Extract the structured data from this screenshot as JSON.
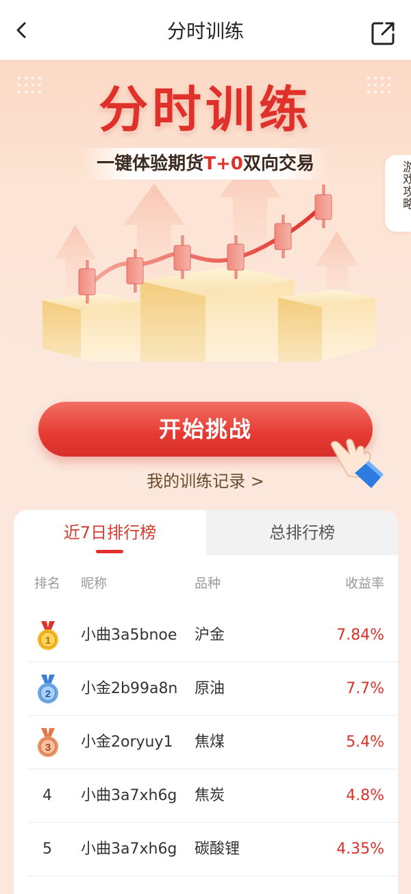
{
  "nav": {
    "title": "分时训练",
    "back_icon": "chevron-left-icon",
    "share_icon": "share-icon"
  },
  "hero": {
    "title": "分时训练",
    "subtitle_prefix": "一键体验期货",
    "subtitle_highlight": "T+0",
    "subtitle_suffix": "双向交易",
    "tips": "游戏攻略"
  },
  "actions": {
    "start_label": "开始挑战",
    "record_link": "我的训练记录 >"
  },
  "leaderboard": {
    "tabs": [
      {
        "label": "近7日排行榜",
        "active": true
      },
      {
        "label": "总排行榜",
        "active": false
      }
    ],
    "columns": {
      "rank": "排名",
      "nickname": "昵称",
      "product": "品种",
      "yield": "收益率"
    },
    "rows": [
      {
        "rank": "1",
        "medal": "gold",
        "nickname": "小曲3a5bnoe",
        "product": "沪金",
        "yield": "7.84%"
      },
      {
        "rank": "2",
        "medal": "silver",
        "nickname": "小金2b99a8n",
        "product": "原油",
        "yield": "7.7%"
      },
      {
        "rank": "3",
        "medal": "bronze",
        "nickname": "小金2oryuy1",
        "product": "焦煤",
        "yield": "5.4%"
      },
      {
        "rank": "4",
        "medal": "",
        "nickname": "小曲3a7xh6g",
        "product": "焦炭",
        "yield": "4.8%"
      },
      {
        "rank": "5",
        "medal": "",
        "nickname": "小曲3a7xh6g",
        "product": "碳酸锂",
        "yield": "4.35%"
      }
    ]
  },
  "colors": {
    "accent": "#e0302a",
    "gold": "#f5b823",
    "silver": "#6aa8e6",
    "bronze": "#e89264"
  }
}
